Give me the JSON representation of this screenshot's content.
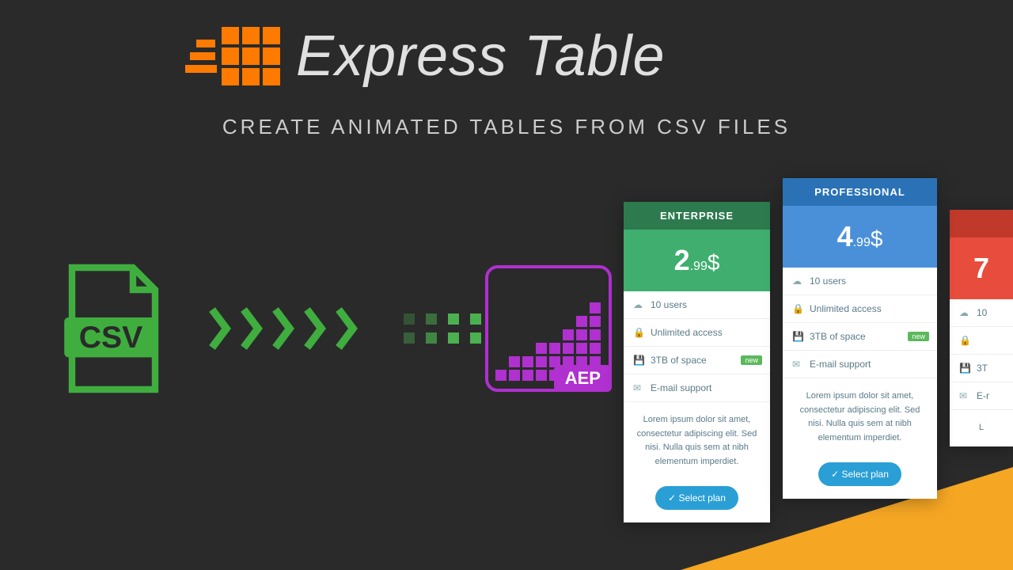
{
  "title": "Express Table",
  "subtitle": "CREATE ANIMATED TABLES FROM CSV FILES",
  "csv_label": "CSV",
  "aep_label": "AEP",
  "cards": [
    {
      "tier": "ENTERPRISE",
      "price_main": "2",
      "price_dec": ".99",
      "currency": "$",
      "features": [
        "10 users",
        "Unlimited access",
        "3TB of space",
        "E-mail support"
      ],
      "new_badge_index": 2,
      "desc": "Lorem ipsum dolor sit amet, consectetur adipiscing elit. Sed nisi. Nulla quis sem at nibh elementum imperdiet.",
      "btn": "Select plan"
    },
    {
      "tier": "PROFESSIONAL",
      "price_main": "4",
      "price_dec": ".99",
      "currency": "$",
      "features": [
        "10 users",
        "Unlimited access",
        "3TB of space",
        "E-mail support"
      ],
      "new_badge_index": 2,
      "desc": "Lorem ipsum dolor sit amet, consectetur adipiscing elit. Sed nisi. Nulla quis sem at nibh elementum imperdiet.",
      "btn": "Select plan"
    },
    {
      "tier": "",
      "price_main": "7",
      "price_dec": "",
      "currency": "",
      "features": [
        "10",
        "",
        "3T",
        "E-r"
      ],
      "desc": "L",
      "btn": ""
    }
  ]
}
